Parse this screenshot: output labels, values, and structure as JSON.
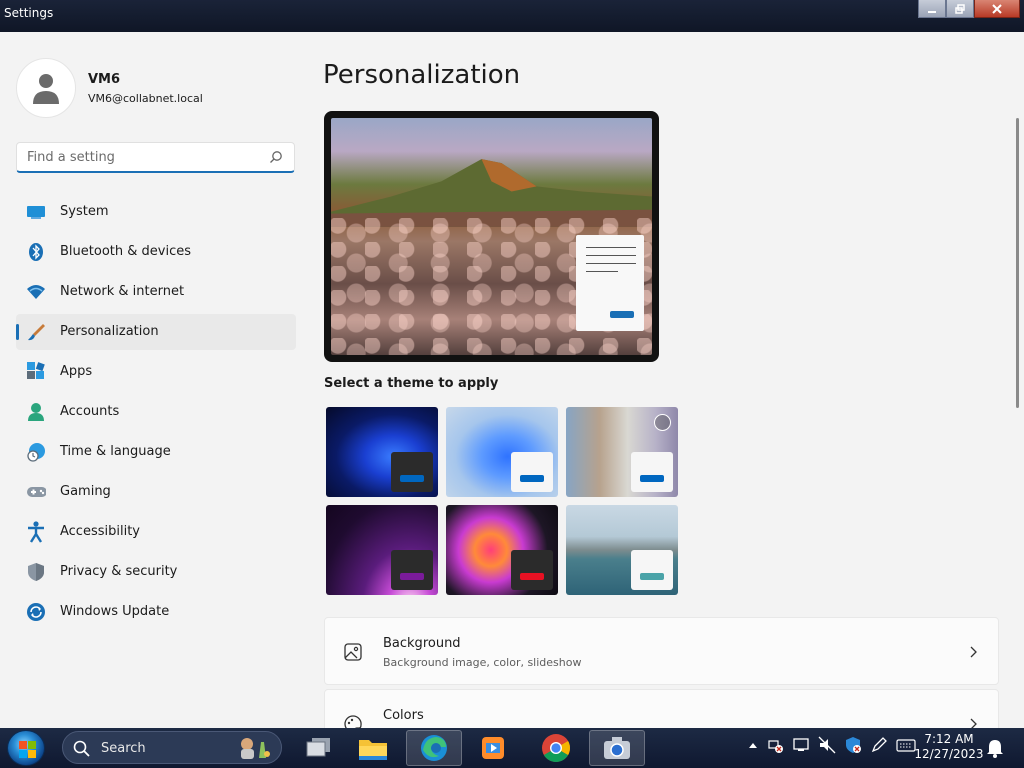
{
  "window": {
    "title": "Settings"
  },
  "user": {
    "name": "VM6",
    "email": "VM6@collabnet.local"
  },
  "search": {
    "placeholder": "Find a setting"
  },
  "nav": {
    "items": [
      {
        "label": "System",
        "icon": "monitor-icon"
      },
      {
        "label": "Bluetooth & devices",
        "icon": "bluetooth-icon"
      },
      {
        "label": "Network & internet",
        "icon": "wifi-icon"
      },
      {
        "label": "Personalization",
        "icon": "brush-icon",
        "active": true
      },
      {
        "label": "Apps",
        "icon": "apps-icon"
      },
      {
        "label": "Accounts",
        "icon": "person-icon"
      },
      {
        "label": "Time & language",
        "icon": "globe-clock-icon"
      },
      {
        "label": "Gaming",
        "icon": "gamepad-icon"
      },
      {
        "label": "Accessibility",
        "icon": "accessibility-icon"
      },
      {
        "label": "Privacy & security",
        "icon": "shield-icon"
      },
      {
        "label": "Windows Update",
        "icon": "update-icon"
      }
    ]
  },
  "main": {
    "title": "Personalization",
    "themes_label": "Select a theme to apply",
    "themes": [
      {
        "name": "windows-dark",
        "accent": "#0067c0"
      },
      {
        "name": "windows-light",
        "accent": "#0067c0"
      },
      {
        "name": "spotlight",
        "accent": "#0067c0"
      },
      {
        "name": "glow",
        "accent": "#7a1b9a"
      },
      {
        "name": "captured-motion",
        "accent": "#e81123"
      },
      {
        "name": "flow",
        "accent": "#4aa3a8"
      }
    ],
    "cards": [
      {
        "title": "Background",
        "subtitle": "Background image, color, slideshow",
        "icon": "image-icon"
      },
      {
        "title": "Colors",
        "subtitle": "",
        "icon": "palette-icon"
      }
    ]
  },
  "taskbar": {
    "search_label": "Search",
    "apps": [
      "task-view",
      "file-explorer",
      "edge",
      "media-player",
      "chrome",
      "screenshot-tool"
    ],
    "time": "7:12 AM",
    "date": "12/27/2023"
  },
  "colors": {
    "accent": "#1a6fb5"
  }
}
